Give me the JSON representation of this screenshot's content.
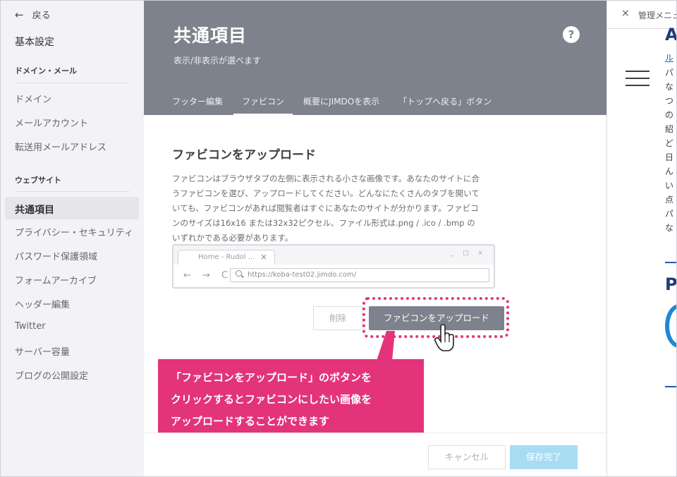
{
  "sidebar": {
    "back_label": "戻る",
    "basic_settings": "基本設定",
    "domain_mail_heading": "ドメイン・メール",
    "items_domain": [
      "ドメイン",
      "メールアカウント",
      "転送用メールアドレス"
    ],
    "website_heading": "ウェブサイト",
    "items_website": [
      "共通項目",
      "プライバシー・セキュリティ",
      "パスワード保護領域",
      "フォームアーカイブ",
      "ヘッダー編集",
      "Twitter",
      "サーバー容量",
      "ブログの公開設定"
    ]
  },
  "header": {
    "title": "共通項目",
    "subtitle": "表示/非表示が選べます",
    "help": "?",
    "tabs": [
      "フッター編集",
      "ファビコン",
      "概要にJIMDOを表示",
      "「トップへ戻る」ボタン"
    ],
    "active_tab": "ファビコン"
  },
  "content": {
    "section_title": "ファビコンをアップロード",
    "description": "ファビコンはブラウザタブの左側に表示される小さな画像です。あなたのサイトに合うファビコンを選び、アップロードしてください。どんなにたくさんのタブを開いていても、ファビコンがあれば閲覧者はすぐにあなたのサイトが分かります。ファビコンのサイズは16x16 または32x32ピクセル、ファイル形式は.png / .ico / .bmp のいずれかである必要があります。",
    "mock_browser": {
      "tab_title": "Home - Rudol ...",
      "tab_close": "×",
      "window_controls": "_ □ ×",
      "nav": "← → C",
      "url": "https://koba-test02.jimdo.com/"
    },
    "delete_button": "削除",
    "upload_button": "ファビコンをアップロード"
  },
  "callout": {
    "lines": [
      "「ファビコンをアップロード」のボタンを",
      "クリックするとファビコンにしたい画像を",
      "アップロードすることができます"
    ]
  },
  "footer": {
    "cancel_button": "キャンセル",
    "save_button": "保存完了"
  },
  "right_pane": {
    "close": "×",
    "admin_label": "管理メニュー",
    "heading_a": "A",
    "link_text": "ル",
    "text_fragments": "パ\nな\nつ\nの\n紹\nど\n日\nん\nい\n点\nパ\nな",
    "heading_p": "P"
  },
  "colors": {
    "header_bg": "#7e828c",
    "callout": "#e3337b",
    "save_button": "#a8dcf3"
  }
}
